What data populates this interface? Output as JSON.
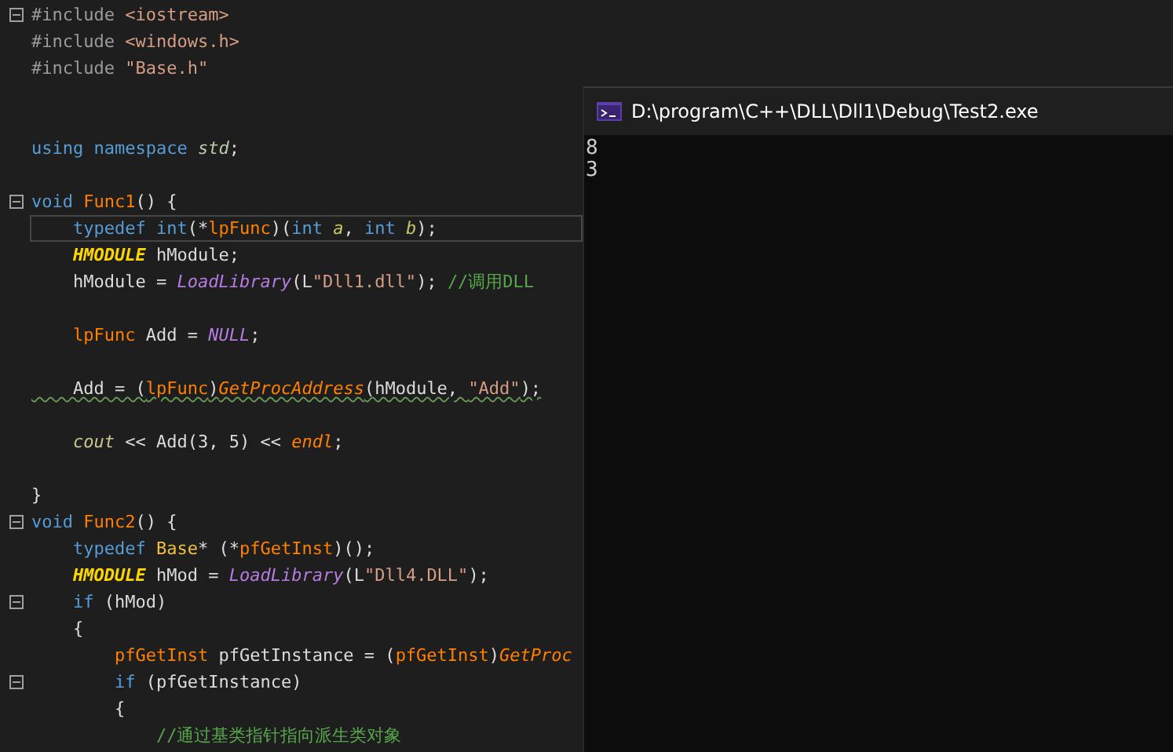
{
  "editor": {
    "lines": [
      {
        "fold": true,
        "tokens": [
          {
            "kind": "pre",
            "text": "#include "
          },
          {
            "kind": "inc",
            "text": "<iostream>"
          }
        ]
      },
      {
        "fold": false,
        "tokens": [
          {
            "kind": "pre",
            "text": "#include "
          },
          {
            "kind": "inc",
            "text": "<windows.h>"
          }
        ]
      },
      {
        "fold": false,
        "tokens": [
          {
            "kind": "pre",
            "text": "#include "
          },
          {
            "kind": "inc",
            "text": "\"Base.h\""
          }
        ]
      },
      {
        "fold": false
      },
      {
        "fold": false
      },
      {
        "fold": false,
        "tokens": [
          {
            "kind": "kw",
            "text": "using namespace "
          },
          {
            "kind": "ns",
            "text": "std"
          },
          {
            "kind": "plain",
            "text": ";"
          }
        ]
      },
      {
        "fold": false
      },
      {
        "fold": true,
        "tokens": [
          {
            "kind": "kw",
            "text": "void "
          },
          {
            "kind": "fn",
            "text": "Func1"
          },
          {
            "kind": "plain",
            "text": "() {"
          }
        ]
      },
      {
        "fold": false,
        "current": true,
        "tokens": [
          {
            "kind": "kw",
            "text": "    typedef int"
          },
          {
            "kind": "plain",
            "text": "(*"
          },
          {
            "kind": "fn",
            "text": "lpFunc"
          },
          {
            "kind": "plain",
            "text": ")("
          },
          {
            "kind": "kw",
            "text": "int "
          },
          {
            "kind": "param",
            "text": "a"
          },
          {
            "kind": "plain",
            "text": ", "
          },
          {
            "kind": "kw",
            "text": "int "
          },
          {
            "kind": "param",
            "text": "b"
          },
          {
            "kind": "plain",
            "text": ");"
          }
        ]
      },
      {
        "fold": false,
        "tokens": [
          {
            "kind": "macro",
            "text": "    HMODULE"
          },
          {
            "kind": "plain",
            "text": " hModule;"
          }
        ]
      },
      {
        "fold": false,
        "tokens": [
          {
            "kind": "plain",
            "text": "    hModule = "
          },
          {
            "kind": "call",
            "text": "LoadLibrary"
          },
          {
            "kind": "plain",
            "text": "(L"
          },
          {
            "kind": "str",
            "text": "\"Dll1.dll\""
          },
          {
            "kind": "plain",
            "text": "); "
          },
          {
            "kind": "comment",
            "text": "//调用DLL"
          }
        ]
      },
      {
        "fold": false
      },
      {
        "fold": false,
        "tokens": [
          {
            "kind": "fn",
            "text": "    lpFunc"
          },
          {
            "kind": "plain",
            "text": " Add = "
          },
          {
            "kind": "call",
            "text": "NULL"
          },
          {
            "kind": "plain",
            "text": ";"
          }
        ]
      },
      {
        "fold": false
      },
      {
        "fold": false,
        "squiggle": true,
        "tokens": [
          {
            "kind": "plain",
            "text": "    Add = ("
          },
          {
            "kind": "fn",
            "text": "lpFunc"
          },
          {
            "kind": "plain",
            "text": ")"
          },
          {
            "kind": "ofn",
            "text": "GetProcAddress"
          },
          {
            "kind": "plain",
            "text": "(hModule, "
          },
          {
            "kind": "str",
            "text": "\"Add\""
          },
          {
            "kind": "plain",
            "text": ");"
          }
        ]
      },
      {
        "fold": false
      },
      {
        "fold": false,
        "tokens": [
          {
            "kind": "io",
            "text": "    cout"
          },
          {
            "kind": "plain",
            "text": " << Add(3, 5) << "
          },
          {
            "kind": "ofn",
            "text": "endl"
          },
          {
            "kind": "plain",
            "text": ";"
          }
        ]
      },
      {
        "fold": false
      },
      {
        "fold": false,
        "tokens": [
          {
            "kind": "plain",
            "text": "}"
          }
        ]
      },
      {
        "fold": true,
        "tokens": [
          {
            "kind": "kw",
            "text": "void "
          },
          {
            "kind": "fn",
            "text": "Func2"
          },
          {
            "kind": "plain",
            "text": "() {"
          }
        ]
      },
      {
        "fold": false,
        "tokens": [
          {
            "kind": "kw",
            "text": "    typedef "
          },
          {
            "kind": "cls",
            "text": "Base"
          },
          {
            "kind": "plain",
            "text": "* (*"
          },
          {
            "kind": "fn",
            "text": "pfGetInst"
          },
          {
            "kind": "plain",
            "text": ")();"
          }
        ]
      },
      {
        "fold": false,
        "tokens": [
          {
            "kind": "macro",
            "text": "    HMODULE"
          },
          {
            "kind": "plain",
            "text": " hMod = "
          },
          {
            "kind": "call",
            "text": "LoadLibrary"
          },
          {
            "kind": "plain",
            "text": "(L"
          },
          {
            "kind": "str",
            "text": "\"Dll4.DLL\""
          },
          {
            "kind": "plain",
            "text": ");"
          }
        ]
      },
      {
        "fold": true,
        "tokens": [
          {
            "kind": "kw",
            "text": "    if"
          },
          {
            "kind": "plain",
            "text": " (hMod)"
          }
        ]
      },
      {
        "fold": false,
        "tokens": [
          {
            "kind": "plain",
            "text": "    {"
          }
        ]
      },
      {
        "fold": false,
        "tokens": [
          {
            "kind": "fn",
            "text": "        pfGetInst"
          },
          {
            "kind": "plain",
            "text": " pfGetInstance = ("
          },
          {
            "kind": "fn",
            "text": "pfGetInst"
          },
          {
            "kind": "plain",
            "text": ")"
          },
          {
            "kind": "ofn",
            "text": "GetProc"
          }
        ]
      },
      {
        "fold": true,
        "tokens": [
          {
            "kind": "kw",
            "text": "        if"
          },
          {
            "kind": "plain",
            "text": " (pfGetInstance)"
          }
        ]
      },
      {
        "fold": false,
        "tokens": [
          {
            "kind": "plain",
            "text": "        {"
          }
        ]
      },
      {
        "fold": false,
        "tokens": [
          {
            "kind": "comment",
            "text": "            //通过基类指针指向派生类对象"
          }
        ]
      }
    ]
  },
  "console": {
    "title": "D:\\program\\C++\\DLL\\Dll1\\Debug\\Test2.exe",
    "output": [
      "8",
      "3"
    ]
  }
}
